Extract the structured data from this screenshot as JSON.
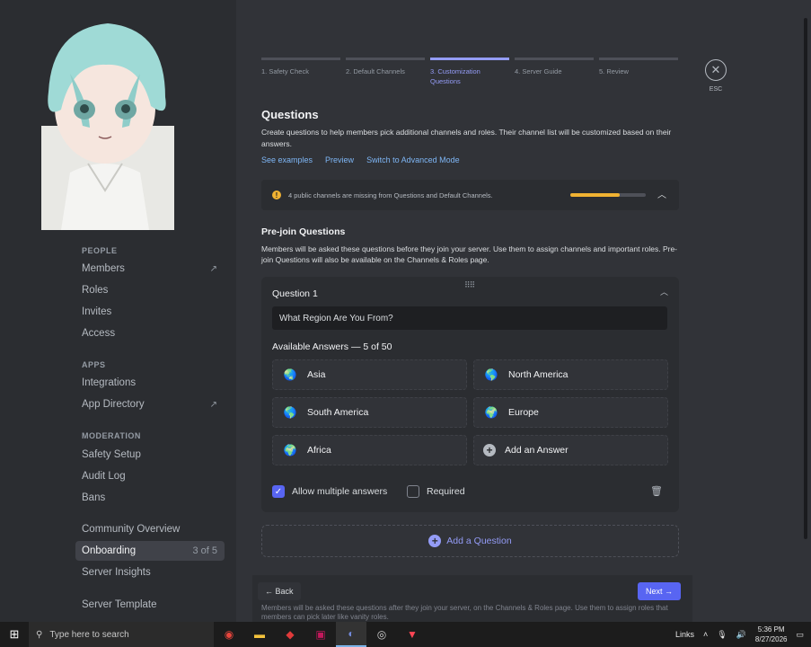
{
  "window": {
    "minimize": "—",
    "maximize": "☐",
    "close": "✕"
  },
  "sidebar": {
    "sections": [
      {
        "title": "PEOPLE",
        "items": [
          {
            "label": "Members",
            "external": true
          },
          {
            "label": "Roles"
          },
          {
            "label": "Invites"
          },
          {
            "label": "Access"
          }
        ]
      },
      {
        "title": "APPS",
        "items": [
          {
            "label": "Integrations"
          },
          {
            "label": "App Directory",
            "external": true
          }
        ]
      },
      {
        "title": "MODERATION",
        "items": [
          {
            "label": "Safety Setup"
          },
          {
            "label": "Audit Log"
          },
          {
            "label": "Bans"
          }
        ]
      },
      {
        "title": "",
        "items": [
          {
            "label": "Community Overview"
          },
          {
            "label": "Onboarding",
            "count": "3 of 5",
            "active": true
          },
          {
            "label": "Server Insights"
          },
          {
            "label": "Server Template"
          }
        ]
      }
    ]
  },
  "steps": [
    {
      "label": "1. Safety Check"
    },
    {
      "label": "2. Default Channels"
    },
    {
      "label": "3. Customization Questions",
      "active": true
    },
    {
      "label": "4. Server Guide"
    },
    {
      "label": "5. Review"
    }
  ],
  "esc": {
    "icon": "✕",
    "label": "ESC"
  },
  "header": {
    "title": "Questions",
    "description": "Create questions to help members pick additional channels and roles. Their channel list will be customized based on their answers.",
    "links": [
      "See examples",
      "Preview",
      "Switch to Advanced Mode"
    ]
  },
  "warning": {
    "text": "4 public channels are missing from Questions and Default Channels.",
    "progress": 0.65,
    "color": "#f0b232"
  },
  "prejoin": {
    "title": "Pre-join Questions",
    "description": "Members will be asked these questions before they join your server. Use them to assign channels and important roles. Pre-join Questions will also be available on the Channels & Roles page."
  },
  "question": {
    "label": "Question 1",
    "value": "What Region Are You From?",
    "answers_title": "Available Answers — 5 of 50",
    "answers": [
      {
        "label": "Asia",
        "icon": "🌏"
      },
      {
        "label": "North America",
        "icon": "🌎"
      },
      {
        "label": "South America",
        "icon": "🌎"
      },
      {
        "label": "Europe",
        "icon": "🌍"
      },
      {
        "label": "Africa",
        "icon": "🌍"
      }
    ],
    "add_answer": "Add an Answer",
    "allow_multiple": {
      "label": "Allow multiple answers",
      "checked": true
    },
    "required": {
      "label": "Required",
      "checked": false
    }
  },
  "add_question": "Add a Question",
  "footer": {
    "back": "← Back",
    "next": "Next →",
    "ghost": "Members will be asked these questions after they join your server, on the Channels & Roles page. Use them to assign roles that members can pick later like vanity roles."
  },
  "taskbar": {
    "search_placeholder": "Type here to search",
    "tray_links": "Links",
    "time": "5:36 PM",
    "date": "8/27/2026"
  }
}
